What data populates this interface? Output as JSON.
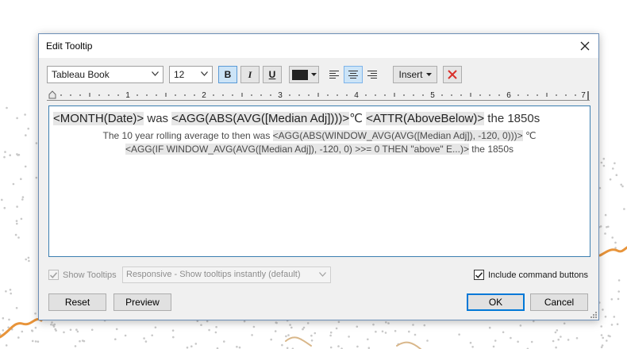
{
  "dialog": {
    "title": "Edit Tooltip",
    "close_icon": "close-icon"
  },
  "toolbar": {
    "font_family": "Tableau Book",
    "font_size": "12",
    "bold": "B",
    "italic": "I",
    "underline": "U",
    "text_color": "#222222",
    "align_left_icon": "align-left-icon",
    "align_center_icon": "align-center-icon",
    "align_right_icon": "align-right-icon",
    "active_alignment": "center",
    "insert_label": "Insert",
    "clear_icon": "clear-formatting-icon"
  },
  "ruler": {
    "labels": [
      "1",
      "2",
      "3",
      "4",
      "5",
      "6",
      "7"
    ]
  },
  "editor": {
    "line1": [
      {
        "text": "<MONTH(Date)>",
        "field": true
      },
      {
        "text": " was ",
        "field": false
      },
      {
        "text": "<AGG(ABS(AVG([Median Adj])))>",
        "field": true
      },
      {
        "text": "℃ ",
        "field": false
      },
      {
        "text": "<ATTR(AboveBelow)>",
        "field": true
      },
      {
        "text": " the 1850s",
        "field": false
      }
    ],
    "line2": [
      {
        "text": "The 10 year rolling average to then was  ",
        "field": false
      },
      {
        "text": "<AGG(ABS(WINDOW_AVG(AVG([Median Adj]), -120, 0)))>",
        "field": true
      },
      {
        "text": " ℃",
        "field": false
      }
    ],
    "line3": [
      {
        "text": "<AGG(IF WINDOW_AVG(AVG([Median Adj]), -120, 0) >>= 0 THEN \"above\" E...)>",
        "field": true
      },
      {
        "text": " the 1850s",
        "field": false
      }
    ]
  },
  "options": {
    "show_tooltips_label": "Show Tooltips",
    "show_tooltips_checked": true,
    "show_tooltips_enabled": false,
    "mode_value": "Responsive - Show tooltips instantly (default)",
    "include_buttons_label": "Include command buttons",
    "include_buttons_checked": true
  },
  "buttons": {
    "reset": "Reset",
    "preview": "Preview",
    "ok": "OK",
    "cancel": "Cancel"
  },
  "colors": {
    "accent": "#0078d7",
    "field_background": "#e6e6e6",
    "background_line": "#e8943a",
    "background_points": "#c8c8c8"
  }
}
